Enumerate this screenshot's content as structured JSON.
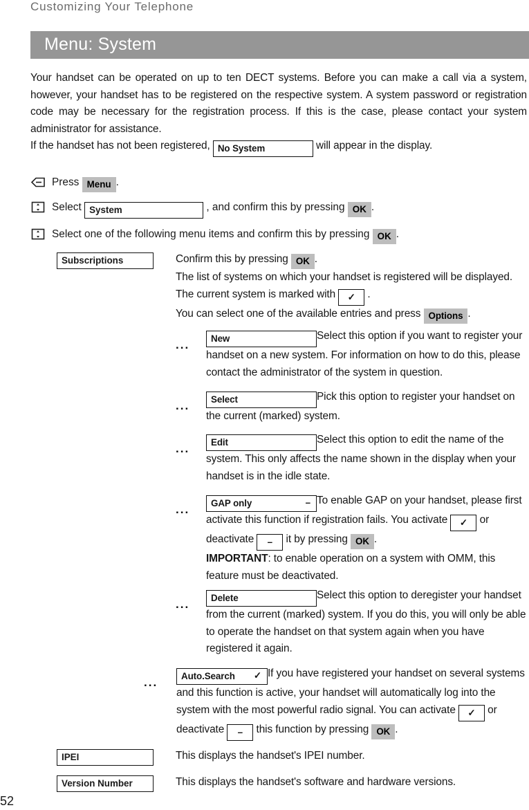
{
  "running_head": "Customizing Your Telephone",
  "title_bar": {
    "text": "Menu: System",
    "bg_color": "#969696",
    "text_color": "#ffffff"
  },
  "intro": {
    "line1": "Your handset can be operated on up to ten DECT systems. Before you can make a call via a system, however, your handset has to be registered on the respective system. A system password or registration code may be necessary for the registration process. If this is the case, please contact your system administrator for assistance.",
    "line2_before": "If the handset has not been registered,",
    "line2_lcd": "No System",
    "line2_after": "will appear in the display."
  },
  "steps": [
    {
      "icon": "softkey-icon",
      "before": "Press",
      "key": "Menu",
      "after": "."
    },
    {
      "icon": "navigation-key-icon",
      "before": "Select",
      "lcd": "System",
      "mid": ", and confirm this by pressing",
      "key": "OK",
      "after": "."
    },
    {
      "icon": "navigation-key-icon",
      "before": "Select one of the following menu items and confirm this by pressing",
      "key": "OK",
      "after": "."
    }
  ],
  "entries": {
    "subscriptions": {
      "label": "Subscriptions",
      "line1_before": "Confirm this by pressing",
      "line1_key": "OK",
      "line1_after": ".",
      "line2": "The list of systems on which your handset is registered will be displayed. The current system is marked with",
      "line2_lcd": "✓",
      "line2_after": ".",
      "line3_before": "You can select one of the available entries and press",
      "line3_key": "Options",
      "line3_after": "."
    },
    "sub_items": [
      {
        "dots": "...",
        "label": "New",
        "mark": "",
        "text": "Select this option if you want to register your handset on a new system. For information on how to do this, please contact the administrator of the system in question."
      },
      {
        "dots": "...",
        "label": "Select",
        "mark": "",
        "text": "Pick this option to register your handset on the current (marked) system."
      },
      {
        "dots": "...",
        "label": "Edit",
        "mark": "",
        "text": "Select this option to edit the name of the system. This only affects the name shown in the display when your handset is in the idle state."
      },
      {
        "dots": "...",
        "label": "GAP only",
        "mark": "–",
        "text_a": "To enable GAP on your handset, please first activate this function if registration fails. You activate",
        "mark_on": "✓",
        "text_b": "or deactivate",
        "mark_off": "–",
        "text_c": "it by pressing",
        "key": "OK",
        "text_d": ".",
        "important_label": "IMPORTANT",
        "important_text": ": to enable operation on a system with OMM, this feature must be deactivated."
      },
      {
        "dots": "...",
        "label": "Delete",
        "mark": "",
        "text": "Select this option to deregister your handset from the current (marked) system. If you do this, you will only be able to operate the handset on that system again when you have registered it again."
      }
    ],
    "auto_search": {
      "dots": "...",
      "label": "Auto.Search",
      "mark": "✓",
      "text_a": "If you have registered your handset on several systems and this function is active, your handset will automatically log into the system with the most powerful radio signal. You can activate",
      "mark_on": "✓",
      "text_b": "or deactivate",
      "mark_off": "–",
      "text_c": "this function by pressing",
      "key": "OK",
      "text_d": "."
    },
    "ipei": {
      "label": "IPEI",
      "text": "This displays the handset's IPEI number."
    },
    "version_number": {
      "label": "Version Number",
      "text": "This displays the handset's software and hardware versions."
    }
  },
  "folio": "52"
}
